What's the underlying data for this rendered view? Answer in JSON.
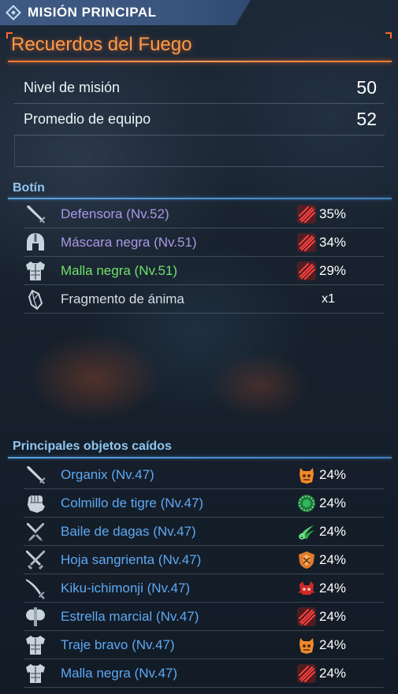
{
  "header": {
    "title": "MISIÓN PRINCIPAL",
    "icon": "quest-diamond-icon"
  },
  "quest": {
    "title": "Recuerdos del Fuego"
  },
  "info": [
    {
      "label": "Nivel de misión",
      "value": "50"
    },
    {
      "label": "Promedio de equipo",
      "value": "52"
    }
  ],
  "loot": {
    "title": "Botín",
    "items": [
      {
        "name": "Defensora (Nv.52)",
        "rate": "35%",
        "icon": "sword-icon",
        "rate_icon": "claw-slash-icon",
        "rarity": "purple"
      },
      {
        "name": "Máscara negra (Nv.51)",
        "rate": "34%",
        "icon": "helmet-icon",
        "rate_icon": "claw-slash-icon",
        "rarity": "purple"
      },
      {
        "name": "Malla negra (Nv.51)",
        "rate": "29%",
        "icon": "armor-icon",
        "rate_icon": "claw-slash-icon",
        "rarity": "green"
      },
      {
        "name": "Fragmento de ánima",
        "qty": "x1",
        "icon": "crystal-icon",
        "rarity": "white"
      }
    ]
  },
  "drops": {
    "title": "Principales objetos caídos",
    "items": [
      {
        "name": "Organix (Nv.47)",
        "rate": "24%",
        "icon": "sword-icon",
        "rate_icon": "orange-beast-icon"
      },
      {
        "name": "Colmillo de tigre (Nv.47)",
        "rate": "24%",
        "icon": "gauntlet-icon",
        "rate_icon": "green-ring-icon"
      },
      {
        "name": "Baile de dagas (Nv.47)",
        "rate": "24%",
        "icon": "dual-daggers-icon",
        "rate_icon": "green-swirl-icon"
      },
      {
        "name": "Hoja sangrienta (Nv.47)",
        "rate": "24%",
        "icon": "dual-swords-icon",
        "rate_icon": "orange-shield-icon"
      },
      {
        "name": "Kiku-ichimonji (Nv.47)",
        "rate": "24%",
        "icon": "katana-icon",
        "rate_icon": "red-crab-icon"
      },
      {
        "name": "Estrella marcial (Nv.47)",
        "rate": "24%",
        "icon": "axe-icon",
        "rate_icon": "claw-slash-icon"
      },
      {
        "name": "Traje bravo (Nv.47)",
        "rate": "24%",
        "icon": "armor-icon",
        "rate_icon": "orange-beast-icon"
      },
      {
        "name": "Malla negra (Nv.47)",
        "rate": "24%",
        "icon": "armor-icon",
        "rate_icon": "claw-slash-icon"
      }
    ]
  },
  "colors": {
    "accent_orange": "#ff7a30",
    "section_blue": "#5aa3e0",
    "rarity_purple": "#a898e6",
    "rarity_green": "#6fe06a",
    "drop_blue": "#5ea8f2"
  }
}
